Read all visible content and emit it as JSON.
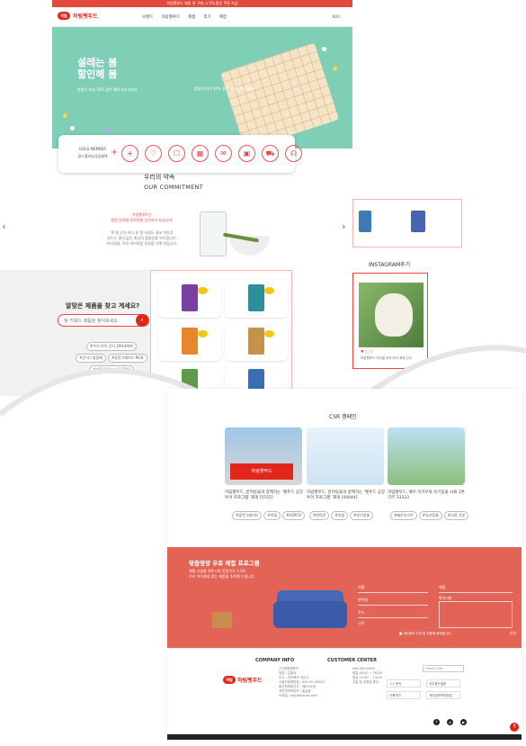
{
  "topbar": {
    "text": "하림펫푸드 회원 첫 구매 시 5% 할인 쿠폰 지급"
  },
  "header": {
    "logo_badge": "하림",
    "logo_text": "하림펫푸드",
    "nav": [
      "브랜드",
      "하림펫푸드",
      "제품",
      "후기",
      "매장"
    ],
    "lang": "KOR"
  },
  "hero": {
    "title": "설레는 봄\n할인해 봄",
    "sub": "봄맞이 최대 30% 할인 혜택 받아가세요",
    "sub2": "봄맞이 최대 30% 할인 혜택 받아가세요"
  },
  "quick": {
    "label": "GOLD MEMBER\n골드멤버십가입혜택",
    "plus": "+",
    "icons": [
      "plus-icon",
      "heart-icon",
      "gift-icon",
      "calendar-icon",
      "coupon-icon",
      "wallet-icon",
      "truck-icon",
      "headset-icon"
    ],
    "glyphs": [
      "+",
      "♡",
      "☐",
      "▦",
      "✉",
      "▣",
      "⛟",
      "☊"
    ]
  },
  "commitment": {
    "title": "우리의 약속",
    "subtitle": "OUR COMMITMENT",
    "red": "하림펫푸드는\n항상 정직한 원료만을 엄선하고 있습니다.",
    "grey": "한 알 간식 하나 한 알 사료도 결코 허투루\n만드는 법이 없는 최상의 품질만을 약속합니다.\n자식처럼, 우리 아이처럼 정성을 다해 만듭니다."
  },
  "finder": {
    "title": "알맞은 제품을 찾고 계세요?",
    "placeholder": "찾 키워드 제품을 찾아보세요",
    "tags": [
      [
        "#우리 아이 간식 100세까지"
      ],
      [
        "#간식 / 영양제",
        "#휴먼그레이드 PICK"
      ],
      [
        "#가장 맛있는 시간 30일"
      ]
    ]
  },
  "instagram": {
    "title": "INSTAGRAM후기",
    "foot": "♥ ◯ ▽",
    "text": "하림펫푸드 더리얼\n우리 아이 최애 간식"
  },
  "csr": {
    "title": "CSR 캠페인",
    "items": [
      {
        "text": "하림펫푸드, 반려동물과 함께하는 '펫푸드 공장 투어 프로그램' 재개 [5555]",
        "tags": [
          "#휴먼그레이드",
          "#하림",
          "#ASPCO"
        ]
      },
      {
        "text": "하림펫푸드, 반려동물과 함께하는 '펫푸드 공장 투어 프로그램' 재개 [44444]",
        "tags": [
          "#반려견",
          "#하림",
          "#유기동물"
        ]
      },
      {
        "text": "하림펫푸드, 배우 이기우와 유기동물 사료 1톤 기부 33333",
        "tags": [
          "#배우이기우",
          "#유기동물",
          "#사료 기부"
        ]
      }
    ]
  },
  "promo": {
    "title": "맞춤영양 무료 체험 프로그램",
    "sub": "체험 신청을 해주시면 전문가가 1:1로\n우리 아이에게 맞는 제품을 추천해 드립니다.",
    "labels": [
      "이름",
      "연락처",
      "주소",
      "견종",
      "나이",
      "체중",
      "특이사항"
    ],
    "agree": "■ 개인정보 수집 및 이용에 동의합니다.",
    "submit": "신청"
  },
  "footer": {
    "logo_badge": "하림",
    "logo_text": "하림펫푸드",
    "company_head": "COMPANY INFO",
    "company_info": "(주)하림펫푸드\n대표 : 김홍국\n주소 : 전라북도 익산시\n사업자등록번호 : 000-00-00000\n통신판매업신고 : 제0000호\n개인정보책임자 : 홍길동\n이메일 : help@harim.com",
    "center_head": "CUSTOMER CENTER",
    "center_info": "080-000-0000\n평일 09:00 ~ 18:00\n점심 12:00 ~ 13:00\n주말 및 공휴일 휴무",
    "select": "Family Site",
    "buttons": [
      "1:1 문의",
      "자주묻는질문",
      "이용약관",
      "개인정보처리방침"
    ],
    "social": [
      "f",
      "◎",
      "▶"
    ]
  }
}
